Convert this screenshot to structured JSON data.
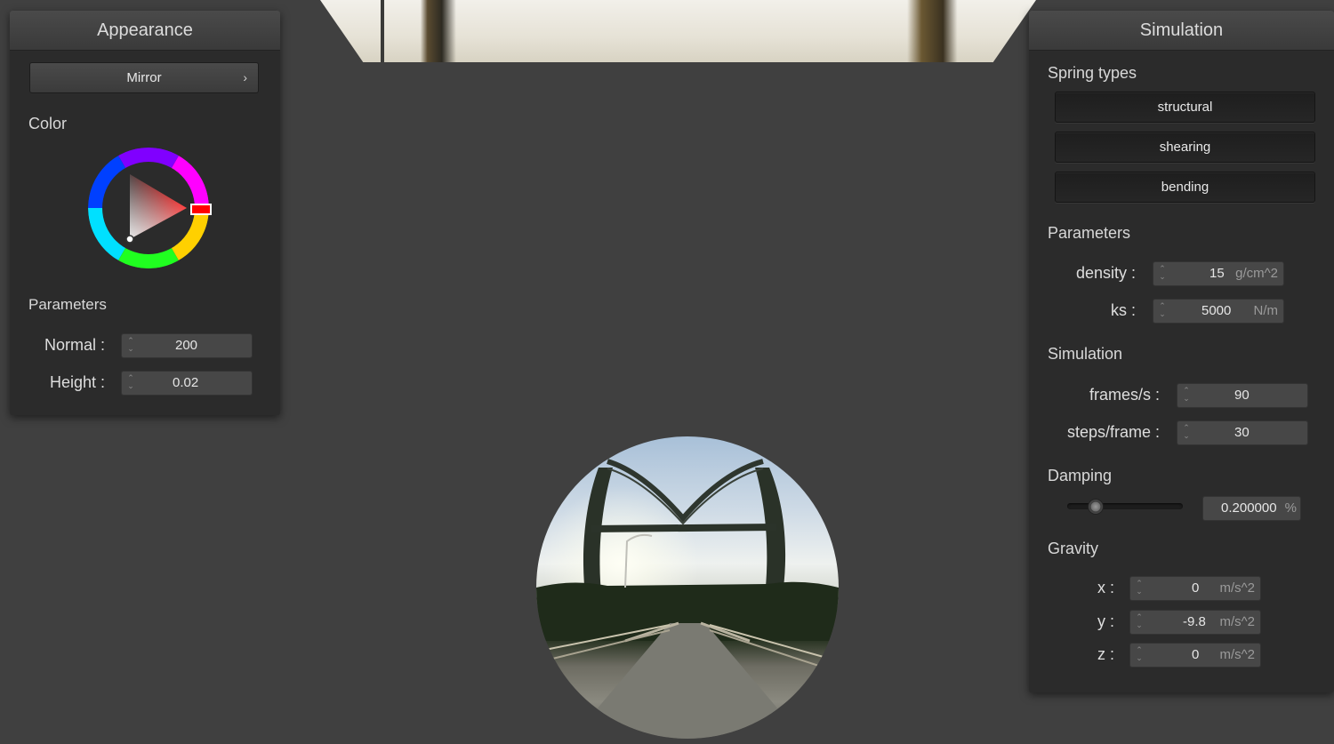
{
  "appearance": {
    "title": "Appearance",
    "mode_button": "Mirror",
    "color_label": "Color",
    "params_label": "Parameters",
    "normal_label": "Normal :",
    "normal_value": "200",
    "height_label": "Height :",
    "height_value": "0.02",
    "selected_hue": "#ff0000"
  },
  "simulation": {
    "title": "Simulation",
    "spring_types_label": "Spring types",
    "spring_types": [
      "structural",
      "shearing",
      "bending"
    ],
    "params_label": "Parameters",
    "density_label": "density :",
    "density_value": "15",
    "density_unit": "g/cm^2",
    "ks_label": "ks :",
    "ks_value": "5000",
    "ks_unit": "N/m",
    "sim_label": "Simulation",
    "fps_label": "frames/s :",
    "fps_value": "90",
    "steps_label": "steps/frame :",
    "steps_value": "30",
    "damping_label": "Damping",
    "damping_value": "0.200000",
    "damping_unit": "%",
    "damping_fraction": 0.2,
    "gravity_label": "Gravity",
    "gx_label": "x :",
    "gx_value": "0",
    "gy_label": "y :",
    "gy_value": "-9.8",
    "gz_label": "z :",
    "gz_value": "0",
    "g_unit": "m/s^2"
  }
}
